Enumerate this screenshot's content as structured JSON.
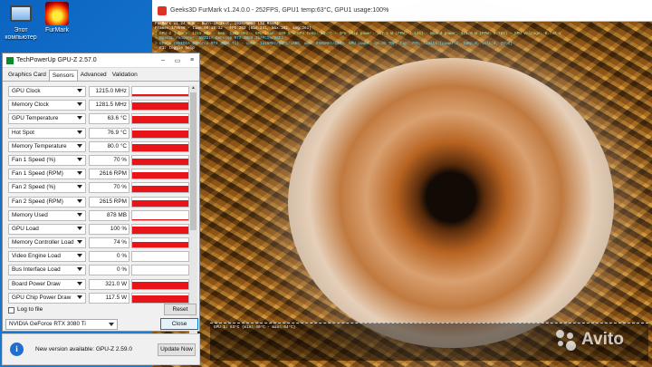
{
  "desktop": {
    "icons": [
      {
        "label_line1": "Этот",
        "label_line2": "компьютер",
        "icon": "computer-icon"
      },
      {
        "label_line1": "FurMark",
        "label_line2": "",
        "icon": "furmark-icon"
      }
    ]
  },
  "furmark": {
    "title": "Geeks3D FurMark v1.24.0.0 - 252FPS, GPU1 temp:63°C, GPU1 usage:100%",
    "overlay_lines": [
      {
        "text": "FurMark v1.24.0.0 - Burn-in test, 1920x1080 (32 MSAA)",
        "color": "white"
      },
      {
        "text": "Frames:179598 - time:00:18:32 - FPS:252 (min:241, max:262, avg:261)",
        "color": "white"
      },
      {
        "text": "[ GPU-Z ] core: 1215 MHz - mem: 1281 MHz - GPU load: 100 % - GPU temp: 63 °C - GPU chip power: 117.5 W (PPW: 2.145) - Board power: 321.0 W (PPW: 0.785) - GPU voltage: 0.743 V",
        "color": "green"
      },
      {
        "text": "> OpenGL renderer: NVIDIA GeForce RTX 3080 Ti/PCIe/SSE2",
        "color": "cyan"
      },
      {
        "text": "> GPU 1 (NVIDIA GeForce RTX 3080 Ti) - core: 1215MHz/63°C/100%, mem: 9501MHz/100%, GPU power: 80.3% TDP, fan: 70%, limits:[power:1, temp:0, volt:0, OV:0]",
        "color": "cyan"
      },
      {
        "text": "- F1: toggle help",
        "color": "white"
      }
    ],
    "graph_label": "GPU 1: 63°C (min: 40°C - max: 64°C)"
  },
  "gpuz": {
    "title": "TechPowerUp GPU-Z 2.57.0",
    "tabs": [
      "Graphics Card",
      "Sensors",
      "Advanced",
      "Validation"
    ],
    "active_tab": "Sensors",
    "sensors": [
      {
        "name": "GPU Clock",
        "value": "1215.0 MHz",
        "level": 0.25
      },
      {
        "name": "Memory Clock",
        "value": "1281.5 MHz",
        "level": 0.8
      },
      {
        "name": "GPU Temperature",
        "value": "63.6 °C",
        "level": 0.8
      },
      {
        "name": "Hot Spot",
        "value": "76.9 °C",
        "level": 0.8
      },
      {
        "name": "Memory Temperature",
        "value": "80.0 °C",
        "level": 0.8
      },
      {
        "name": "Fan 1 Speed (%)",
        "value": "70 %",
        "level": 0.7
      },
      {
        "name": "Fan 1 Speed (RPM)",
        "value": "2616 RPM",
        "level": 0.7
      },
      {
        "name": "Fan 2 Speed (%)",
        "value": "70 %",
        "level": 0.7
      },
      {
        "name": "Fan 2 Speed (RPM)",
        "value": "2615 RPM",
        "level": 0.7
      },
      {
        "name": "Memory Used",
        "value": "878 MB",
        "level": 0.1
      },
      {
        "name": "GPU Load",
        "value": "100 %",
        "level": 0.75
      },
      {
        "name": "Memory Controller Load",
        "value": "74 %",
        "level": 0.6
      },
      {
        "name": "Video Engine Load",
        "value": "0 %",
        "level": 0
      },
      {
        "name": "Bus Interface Load",
        "value": "0 %",
        "level": 0
      },
      {
        "name": "Board Power Draw",
        "value": "321.0 W",
        "level": 0.8
      },
      {
        "name": "GPU Chip Power Draw",
        "value": "117.5 W",
        "level": 0.8
      }
    ],
    "log_label": "Log to file",
    "reset_label": "Reset",
    "gpu_selected": "NVIDIA GeForce RTX 3080 Ti",
    "close_label": "Close"
  },
  "update": {
    "message": "New version available: GPU-Z 2.59.0",
    "button_label": "Update Now"
  },
  "watermark": {
    "text": "Avito"
  },
  "colors": {
    "sensor_fill": "#e8141a",
    "desktop_blue": "#0f5aa8"
  }
}
